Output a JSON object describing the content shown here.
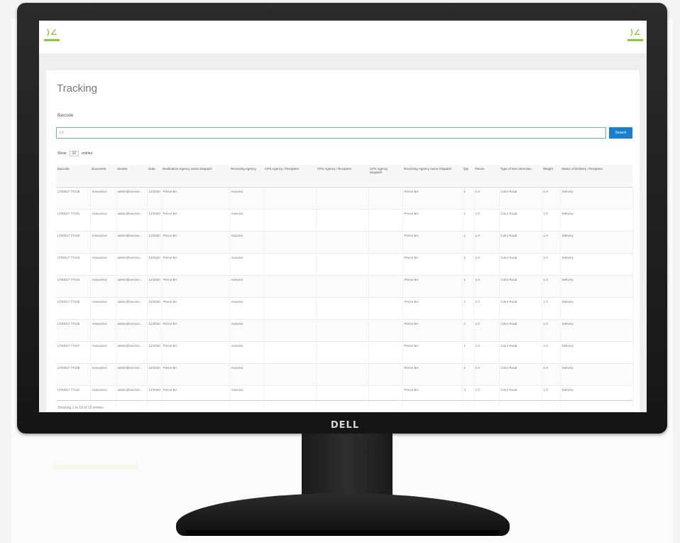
{
  "device": {
    "brand": "DELL"
  },
  "app": {
    "logo_icon": "brand-logo-icon",
    "accent": "#8cc63f",
    "primary": "#1b7fcc"
  },
  "page": {
    "title": "Tracking",
    "search_label": "Barcode",
    "search_value": "LT",
    "search_button": "Search",
    "show_label": "Show",
    "entries_value": "10",
    "entries_label": "entries",
    "footer": "Showing 1 to 10 of 10 entries"
  },
  "table": {
    "columns": [
      "Barcode",
      "Document",
      "Sender",
      "Date",
      "Destination Agency name Dispatch",
      "Receiving Agency",
      "CPS Agency / Recipient",
      "CPS Agency / Recipient",
      "CPS Agency Dispatch",
      "Receiving Agency name Dispatch",
      "Qty",
      "Pieces",
      "Type of Item Direction",
      "Weight",
      "Status of Delivery / Recipient"
    ],
    "rows": [
      [
        "LT00017 77109",
        "Assurance",
        "admin@service...",
        "12/2020",
        "Prince BA",
        "Assurea",
        "",
        "",
        "",
        "Prince BA",
        "1",
        "1.0",
        "Color Road",
        "1.0",
        "Delivery"
      ],
      [
        "LT00017 77101",
        "Assurance",
        "admin@service...",
        "12/2020",
        "Prince BA",
        "Assurea",
        "",
        "",
        "",
        "Prince BA",
        "1",
        "1.0",
        "Color Road",
        "1.0",
        "Delivery"
      ],
      [
        "LT00017 77102",
        "Assurance",
        "admin@service...",
        "12/2020",
        "Prince BA",
        "Assurea",
        "",
        "",
        "",
        "Prince BA",
        "1",
        "1.0",
        "Color Road",
        "1.0",
        "Delivery"
      ],
      [
        "LT00017 77103",
        "Assurance",
        "admin@service...",
        "12/2020",
        "Prince BA",
        "Assurea",
        "",
        "",
        "",
        "Prince BA",
        "1",
        "1.0",
        "Color Road",
        "1.0",
        "Delivery"
      ],
      [
        "LT00017 77104",
        "Assurance",
        "admin@service...",
        "12/2020",
        "Prince BA",
        "Assurea",
        "",
        "",
        "",
        "Prince BA",
        "1",
        "1.0",
        "Color Road",
        "1.0",
        "Delivery"
      ],
      [
        "LT00017 77105",
        "Assurance",
        "admin@service...",
        "12/2020",
        "Prince BA",
        "Assurea",
        "",
        "",
        "",
        "Prince BA",
        "1",
        "1.0",
        "Color Road",
        "1.0",
        "Delivery"
      ],
      [
        "LT00017 77106",
        "Assurance",
        "admin@service...",
        "12/2020",
        "Prince BA",
        "Assurea",
        "",
        "",
        "",
        "Prince BA",
        "1",
        "1.0",
        "Color Road",
        "1.0",
        "Delivery"
      ],
      [
        "LT00017 77107",
        "Assurance",
        "admin@service...",
        "12/2020",
        "Prince BA",
        "Assurea",
        "",
        "",
        "",
        "Prince BA",
        "1",
        "1.0",
        "Color Road",
        "1.0",
        "Delivery"
      ],
      [
        "LT00017 77108",
        "Assurance",
        "admin@service...",
        "12/2020",
        "Prince BA",
        "Assurea",
        "",
        "",
        "",
        "Prince BA",
        "1",
        "1.0",
        "Color Road",
        "1.0",
        "Delivery"
      ],
      [
        "LT00017 77110",
        "Assurance",
        "admin@service...",
        "12/2020",
        "Prince BA",
        "Assurea",
        "",
        "",
        "",
        "Prince BA",
        "4",
        "1.0",
        "Color Road",
        "1.0",
        "Delivery"
      ]
    ]
  }
}
